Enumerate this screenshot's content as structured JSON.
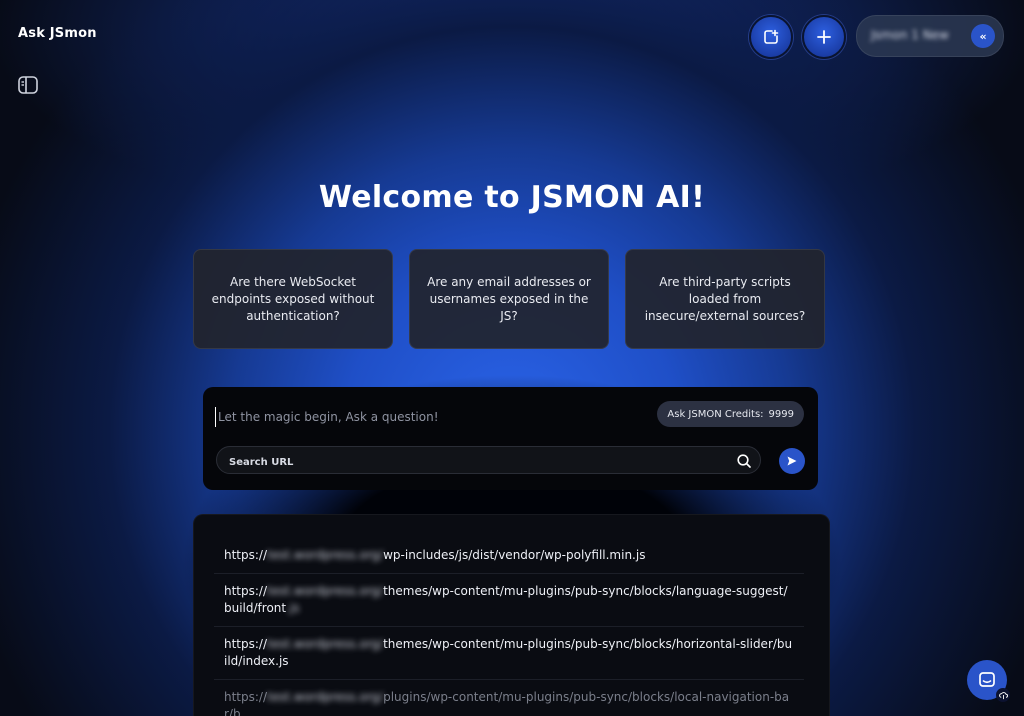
{
  "app": {
    "title": "Ask JSmon"
  },
  "header": {
    "project_name": "Jsmon 1 New",
    "collapse_icon": "«"
  },
  "main": {
    "welcome": "Welcome to JSMON AI!",
    "suggestions": [
      "Are there WebSocket endpoints exposed without authentication?",
      "Are any email addresses or usernames exposed in the JS?",
      "Are third-party scripts loaded from insecure/external sources?"
    ]
  },
  "chat": {
    "question_placeholder": "Let the magic begin, Ask a question!",
    "credits_label": "Ask JSMON Credits:",
    "credits_value": "9999",
    "search_placeholder": "Search URL"
  },
  "urls": [
    {
      "prefix": "https://",
      "host": "test.wordpress.org/",
      "path": "wp-includes/js/dist/vendor/wp-polyfill.min.js"
    },
    {
      "prefix": "https://",
      "host": "test.wordpress.org/",
      "path": "themes/wp-content/mu-plugins/pub-sync/blocks/language-suggest/build/front",
      "tail": ".js"
    },
    {
      "prefix": "https://",
      "host": "test.wordpress.org/",
      "path": "themes/wp-content/mu-plugins/pub-sync/blocks/horizontal-slider/build/index.js"
    },
    {
      "prefix": "https://",
      "host": "test.wordpress.org/",
      "path": "plugins/wp-content/mu-plugins/pub-sync/blocks/local-navigation-bar/b"
    }
  ],
  "colors": {
    "accent": "#2a54c9",
    "background": "#070b17",
    "card": "#22242c"
  },
  "icons": {
    "sidebar_toggle": "sidebar-panel-icon",
    "new_chat": "new-chat-icon",
    "add": "plus-icon",
    "search": "magnifier-icon",
    "send": "paper-plane-icon",
    "help": "chat-bubble-icon"
  }
}
